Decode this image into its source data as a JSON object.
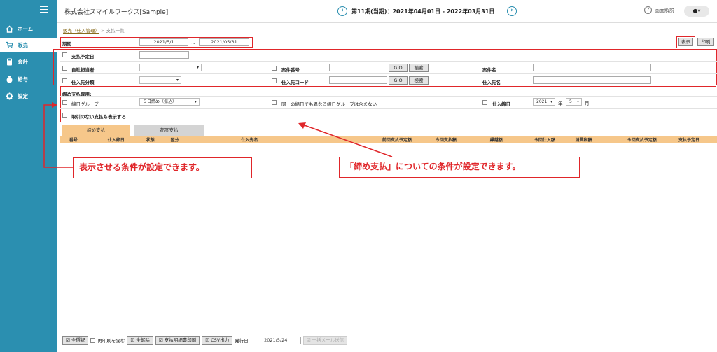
{
  "sidebar": {
    "items": [
      {
        "label": "ホーム",
        "icon": "home-icon"
      },
      {
        "label": "販売",
        "icon": "cart-icon"
      },
      {
        "label": "会計",
        "icon": "calculator-icon"
      },
      {
        "label": "給与",
        "icon": "money-bag-icon"
      },
      {
        "label": "設定",
        "icon": "gear-icon"
      }
    ]
  },
  "header": {
    "company": "株式会社スマイルワークス[Sample]",
    "period": "第11期(当期)：2021年04月01日 - 2022年03月31日",
    "help": "画面解説"
  },
  "breadcrumb": {
    "parent": "販売（仕入管理）",
    "sep": " > ",
    "current": "支払一覧"
  },
  "filters": {
    "period_label": "期間",
    "period_from": "2021/5/1",
    "period_tilde": "～",
    "period_to": "2021/05/31",
    "show_button": "表示",
    "print_button": "印刷",
    "due_date_label": "支払予定日",
    "staff_label": "自社担当者",
    "supplier_class_label": "仕入先分類",
    "project_no_label": "案件番号",
    "supplier_code_label": "仕入先コード",
    "go_label": "G O",
    "search_label": "検索",
    "project_name_label": "案件名",
    "supplier_name_label": "仕入先名"
  },
  "closing": {
    "section_label": "締め支払専用:",
    "group_label": "締日グループ",
    "group_value": "５日締め（振込）",
    "exclude_label": "同一の締日でも異なる締日グループは含まない",
    "closing_date_label": "仕入締日",
    "year_value": "2021",
    "year_unit": "年",
    "month_value": "5",
    "month_unit": "月",
    "no_transaction_label": "取引のない支払も表示する"
  },
  "tabs": [
    "締め支払",
    "都度支払"
  ],
  "table": {
    "columns": [
      "番号",
      "仕入締日",
      "状態",
      "区分",
      "仕入先名",
      "前回支払予定額",
      "今回支払額",
      "繰越額",
      "今回仕入額",
      "消費税額",
      "今回支払予定額",
      "支払予定日"
    ]
  },
  "callouts": {
    "left": "表示させる条件が設定できます。",
    "right": "「締め支払」についての条件が設定できます。"
  },
  "footer": {
    "select_all": "全選択",
    "include_reprint": "再印刷を含む",
    "deselect_all": "全解除",
    "print_statement": "支払明細書印刷",
    "csv_output": "CSV出力",
    "issue_date_label": "発行日",
    "issue_date": "2021/5/24",
    "bulk_mail": "一括メール送信"
  },
  "colors": {
    "sidebar": "#2b8fb0",
    "accent_red": "#e0262a",
    "table_header": "#f6c78a"
  }
}
